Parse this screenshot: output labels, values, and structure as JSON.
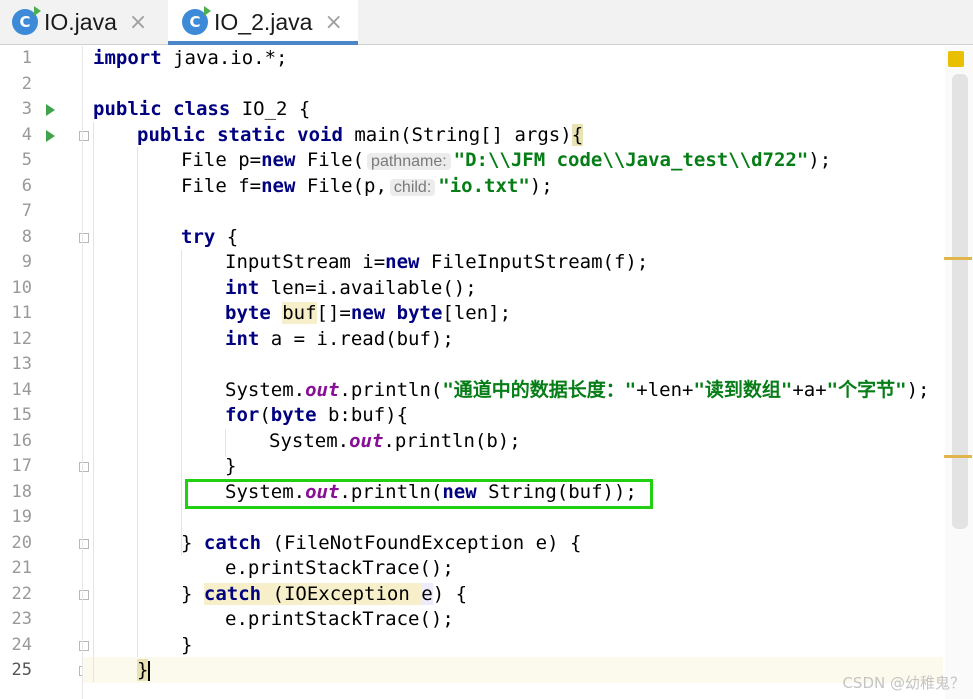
{
  "tabs": [
    {
      "icon": "C",
      "label": "IO.java",
      "close": "×"
    },
    {
      "icon": "C",
      "label": "IO_2.java",
      "close": "×"
    }
  ],
  "gutter": {
    "line_numbers": [
      "1",
      "2",
      "3",
      "4",
      "5",
      "6",
      "7",
      "8",
      "9",
      "10",
      "11",
      "12",
      "13",
      "14",
      "15",
      "16",
      "17",
      "18",
      "19",
      "20",
      "21",
      "22",
      "23",
      "24",
      "25"
    ]
  },
  "code": {
    "l1": {
      "kw": "import",
      "rest": " java.io.*;"
    },
    "l3": {
      "kw": "public class",
      "rest": " IO_2 {"
    },
    "l4": {
      "kw": "public static void",
      "rest": " main(String[] args)",
      "brace": "{"
    },
    "l5": {
      "a": "File p=",
      "kw": "new",
      "b": " File(",
      "hint": "pathname:",
      "str": "\"D:\\\\JFM code\\\\Java_test\\\\d722\"",
      "end": ");"
    },
    "l6": {
      "a": "File f=",
      "kw": "new",
      "b": " File(p,",
      "hint": "child:",
      "str": "\"io.txt\"",
      "end": ");"
    },
    "l8": {
      "kw": "try",
      "rest": " {"
    },
    "l9": {
      "a": "InputStream i=",
      "kw": "new",
      "b": " FileInputStream(f);"
    },
    "l10": {
      "kw": "int",
      "rest": " len=i.available();"
    },
    "l11": {
      "kw": "byte",
      "sp": " ",
      "var": "buf",
      "a": "[]=",
      "kw2": "new",
      "sp2": " ",
      "kw3": "byte",
      "b": "[len];"
    },
    "l12": {
      "kw": "int",
      "rest": " a = i.read(buf);"
    },
    "l14": {
      "a": "System.",
      "fld": "out",
      "b": ".println(",
      "s1": "\"通道中的数据长度：\"",
      "c": "+len+",
      "s2": "\"读到数组\"",
      "d": "+a+",
      "s3": "\"个字节\"",
      "e": ");"
    },
    "l15": {
      "kw": "for",
      "a": "(",
      "kw2": "byte",
      "b": " b:buf){"
    },
    "l16": {
      "a": "System.",
      "fld": "out",
      "b": ".println(b);"
    },
    "l17": {
      "a": "}"
    },
    "l18": {
      "a": "System.",
      "fld": "out",
      "b": ".println(",
      "kw": "new",
      "c": " String(buf));"
    },
    "l20": {
      "a": "} ",
      "kw": "catch",
      "b": " (FileNotFoundException e) {"
    },
    "l21": {
      "a": "e.printStackTrace();"
    },
    "l22": {
      "a": "} ",
      "kw": "catch",
      "b": " (IOException",
      "sp": " ",
      "name": "e",
      "c": ") {"
    },
    "l23": {
      "a": "e.printStackTrace();"
    },
    "l24": {
      "a": "}"
    },
    "l25": {
      "brace": "}"
    }
  },
  "watermark": "CSDN @幼稚鬼？",
  "colors": {
    "keyword": "#000080",
    "string": "#067d17",
    "field": "#871094",
    "highlight_box": "#22d012",
    "tab_underline": "#4a86c8"
  }
}
